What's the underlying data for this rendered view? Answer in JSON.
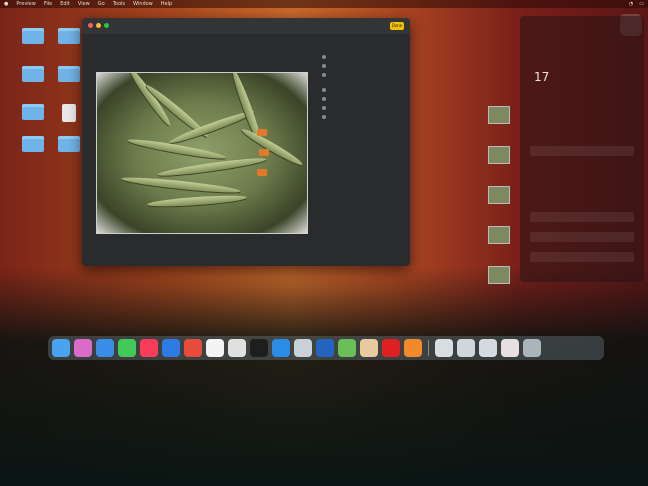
{
  "menubar": {
    "app": "Preview",
    "items": [
      "File",
      "Edit",
      "View",
      "Go",
      "Tools",
      "Window",
      "Help"
    ]
  },
  "desktop_icons": [
    {
      "label": ""
    },
    {
      "label": ""
    },
    {
      "label": ""
    },
    {
      "label": ""
    },
    {
      "label": ""
    },
    {
      "label": ""
    },
    {
      "label": ""
    },
    {
      "label": ""
    }
  ],
  "preview": {
    "done_label": "Done"
  },
  "side_panel": {
    "clock": "17",
    "items": [
      "",
      "",
      "",
      ""
    ]
  },
  "dock_apps": [
    "Finder",
    "Launchpad",
    "Safari",
    "Messages",
    "Music",
    "Maps",
    "Photos",
    "Chrome",
    "Clock",
    "Terminal",
    "VS Code",
    "Preview",
    "Ki",
    "Notes",
    "YouTube",
    "Photos Library",
    "Doc 1",
    "Doc 2",
    "Doc 3",
    "Doc 4",
    "Trash"
  ]
}
